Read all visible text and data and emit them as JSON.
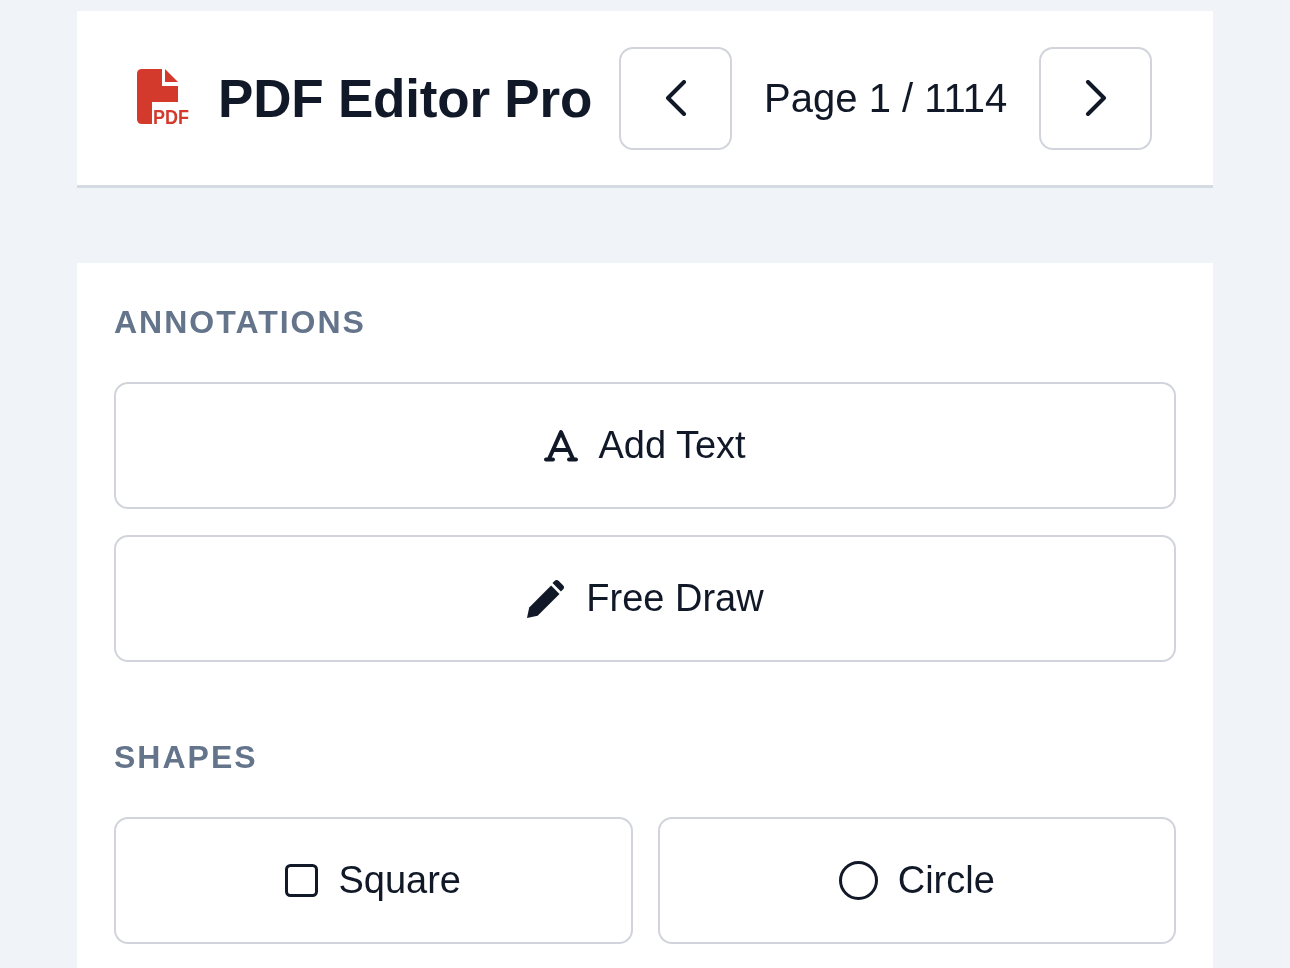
{
  "header": {
    "logo_text": "PDF",
    "app_title": "PDF Editor Pro",
    "page_indicator": "Page 1 / 1114"
  },
  "sections": [
    {
      "title": "ANNOTATIONS",
      "kind": "stack",
      "buttons": [
        {
          "label": "Add Text",
          "kind": "text"
        },
        {
          "label": "Free Draw",
          "kind": "draw"
        }
      ]
    },
    {
      "title": "SHAPES",
      "kind": "grid",
      "buttons": [
        {
          "label": "Square",
          "kind": "square"
        },
        {
          "label": "Circle",
          "kind": "circle"
        }
      ]
    }
  ]
}
